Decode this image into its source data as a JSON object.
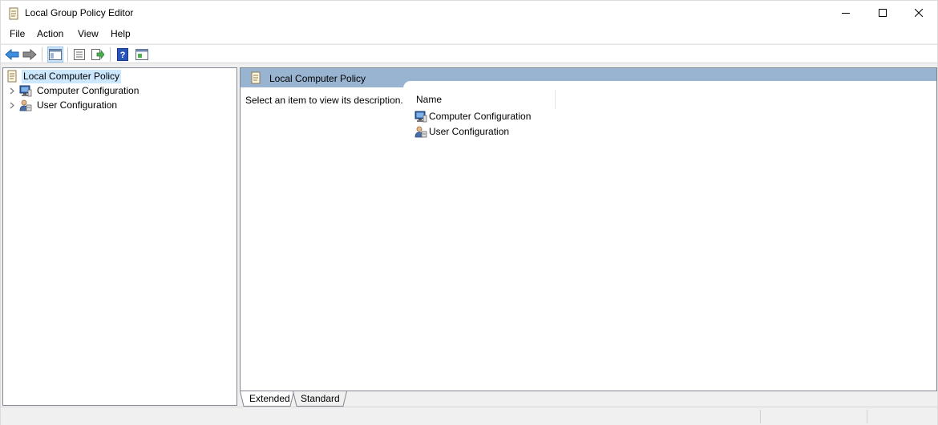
{
  "window": {
    "title": "Local Group Policy Editor"
  },
  "menu": {
    "items": [
      "File",
      "Action",
      "View",
      "Help"
    ]
  },
  "toolbar": {
    "buttons": [
      "back-icon",
      "forward-icon",
      "show-hide-tree-icon",
      "properties-icon",
      "export-list-icon",
      "help-icon",
      "show-hide-action-pane-icon"
    ]
  },
  "tree": {
    "root_label": "Local Computer Policy",
    "children": [
      {
        "label": "Computer Configuration"
      },
      {
        "label": "User Configuration"
      }
    ]
  },
  "details": {
    "header_title": "Local Computer Policy",
    "description": "Select an item to view its description.",
    "column_name": "Name",
    "items": [
      {
        "label": "Computer Configuration"
      },
      {
        "label": "User Configuration"
      }
    ]
  },
  "tabs": {
    "extended": "Extended",
    "standard": "Standard"
  },
  "colors": {
    "header_band": "#98b4d0",
    "selection": "#cce8ff",
    "pressed_button": "#cce4f7"
  }
}
